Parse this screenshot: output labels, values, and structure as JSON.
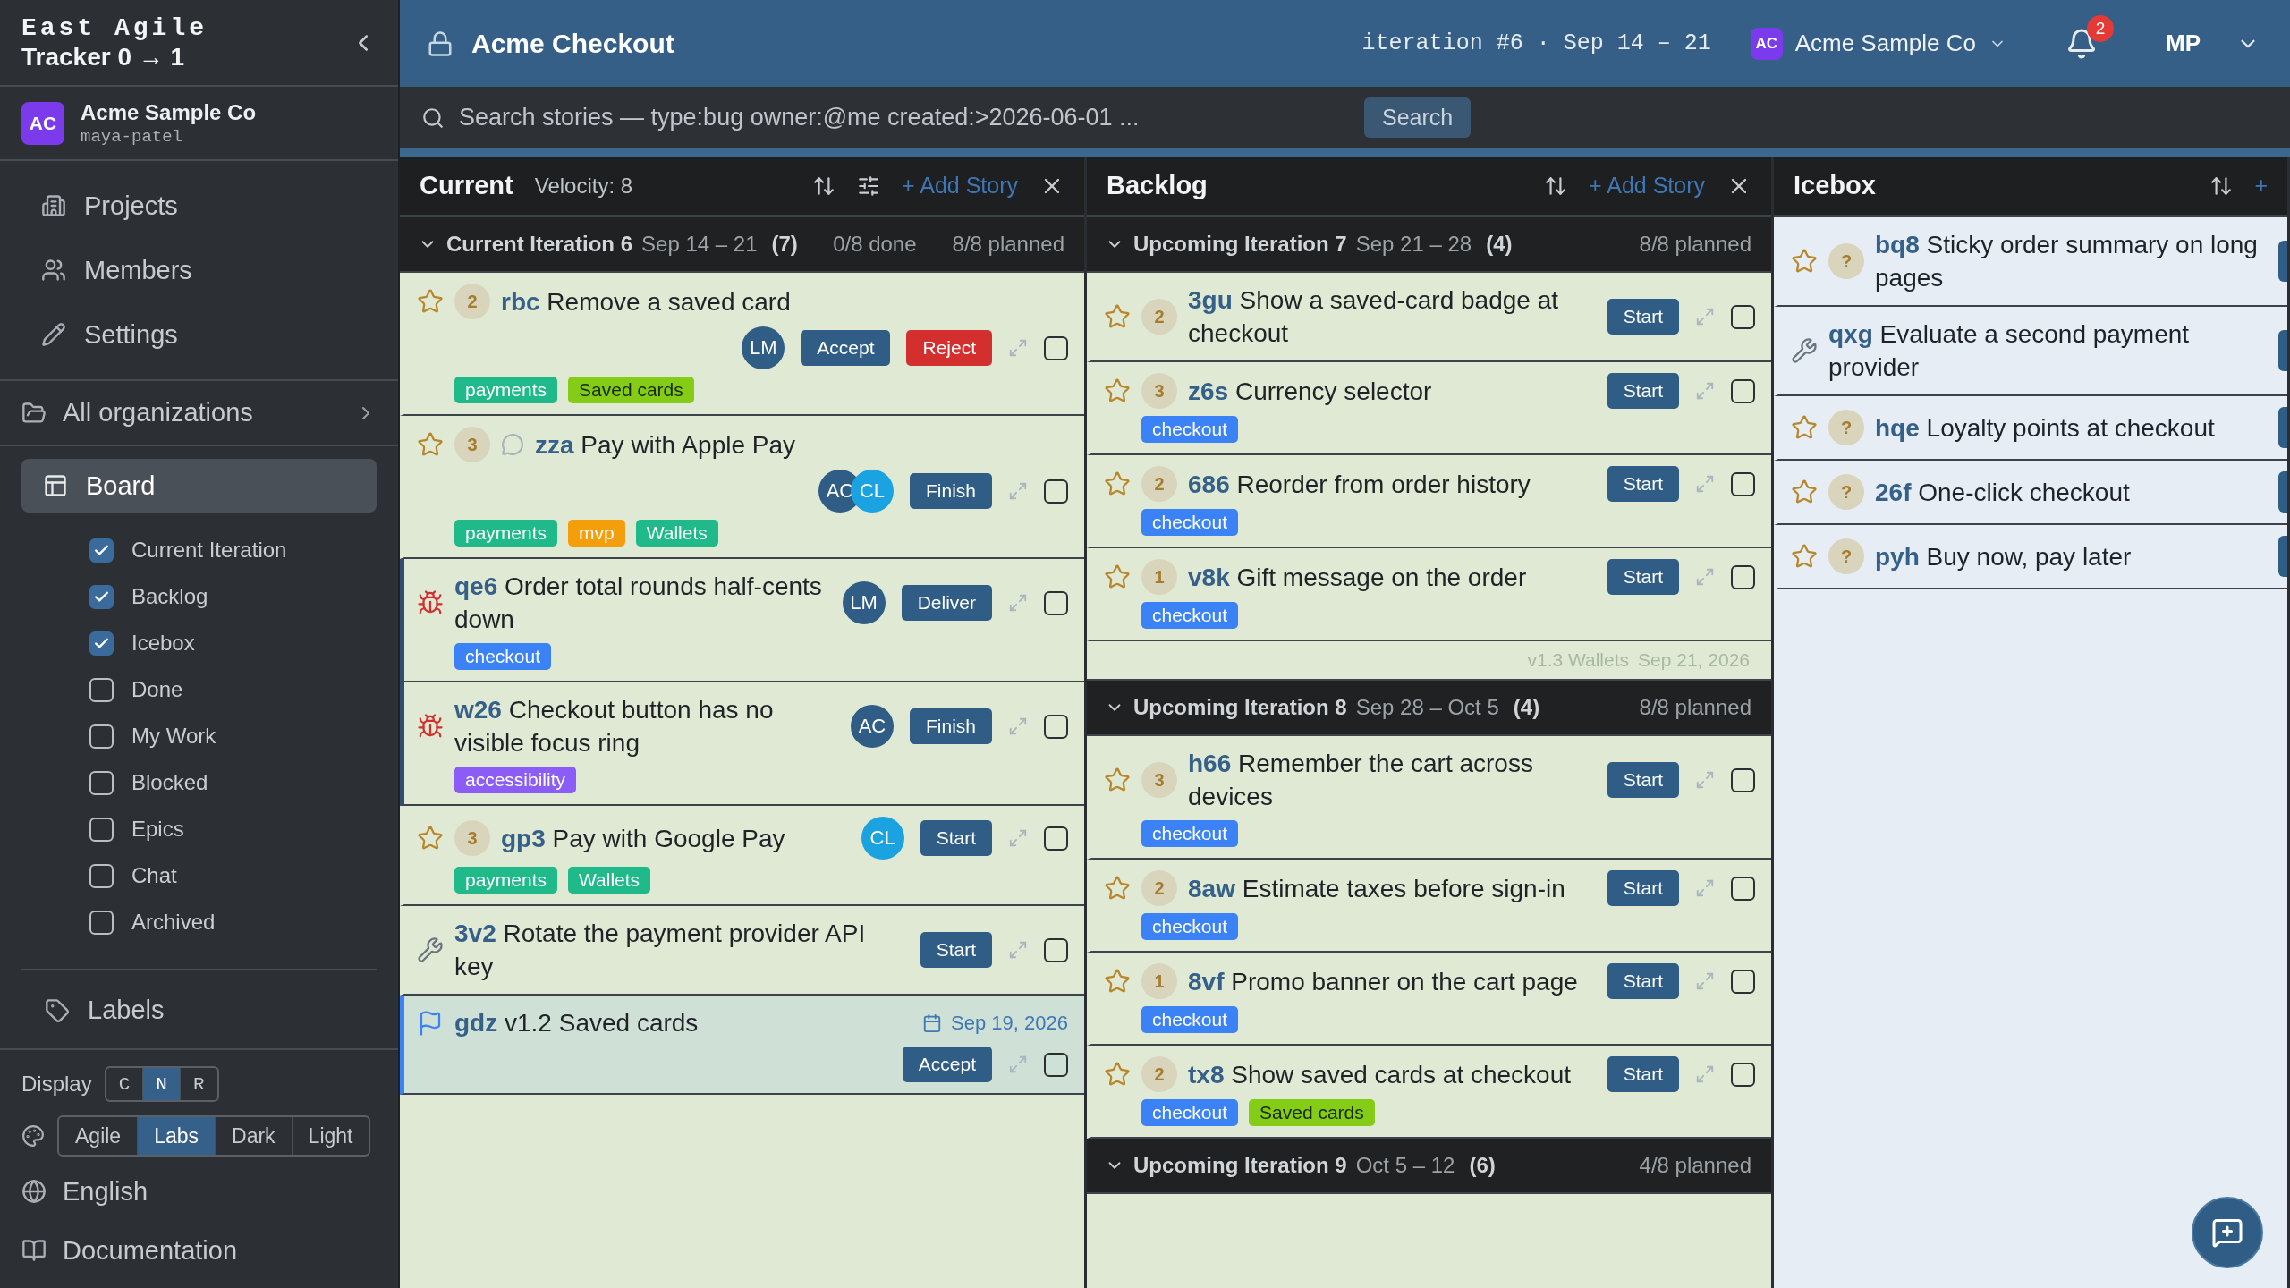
{
  "sidebar": {
    "brand": {
      "line1": "East Agile",
      "line2": "Tracker 0 → 1"
    },
    "org": {
      "avatar": "AC",
      "name": "Acme Sample Co",
      "user": "maya-patel"
    },
    "nav": [
      {
        "kind": "projects",
        "label": "Projects"
      },
      {
        "kind": "members",
        "label": "Members"
      },
      {
        "kind": "settings",
        "label": "Settings"
      }
    ],
    "all_orgs": "All organizations",
    "board": {
      "label": "Board",
      "selected": true
    },
    "panels": [
      {
        "label": "Current Iteration",
        "checked": true
      },
      {
        "label": "Backlog",
        "checked": true
      },
      {
        "label": "Icebox",
        "checked": true
      },
      {
        "label": "Done",
        "checked": false
      },
      {
        "label": "My Work",
        "checked": false
      },
      {
        "label": "Blocked",
        "checked": false
      },
      {
        "label": "Epics",
        "checked": false
      },
      {
        "label": "Chat",
        "checked": false
      },
      {
        "label": "Archived",
        "checked": false
      }
    ],
    "labels": "Labels",
    "display": {
      "label": "Display",
      "options": [
        {
          "label": "C",
          "selected": false
        },
        {
          "label": "N",
          "selected": true
        },
        {
          "label": "R",
          "selected": false
        }
      ]
    },
    "themes": [
      {
        "label": "Agile",
        "selected": false
      },
      {
        "label": "Labs",
        "selected": true
      },
      {
        "label": "Dark",
        "selected": false
      },
      {
        "label": "Light",
        "selected": false
      }
    ],
    "language": "English",
    "docs": "Documentation"
  },
  "header": {
    "project": "Acme Checkout",
    "iteration": "iteration #6 · Sep 14 – 21",
    "org": {
      "avatar": "AC",
      "name": "Acme Sample Co"
    },
    "notifications": "2",
    "user": "MP"
  },
  "search": {
    "placeholder": "Search stories — type:bug owner:@me created:>2026-06-01 ...",
    "button": "Search"
  },
  "columns": [
    {
      "kind": "current",
      "title": "Current",
      "velocity": "Velocity: 8",
      "filter": true,
      "add_story": "+ Add Story",
      "closable": true,
      "cut_off": false,
      "items": [
        {
          "kind": "iteration",
          "title": "Current Iteration 6",
          "dates": "Sep 14 – 21",
          "count": "(7)",
          "done": "0/8 done",
          "planned": "8/8 planned",
          "expanded": true
        },
        {
          "kind": "feature",
          "points": "2",
          "comment": false,
          "id": "rbc",
          "title": "Remove a saved card",
          "owners": [
            {
              "initials": "LM",
              "color": "#2f5d86"
            }
          ],
          "actions": [
            {
              "label": "Accept",
              "kind": "primary"
            },
            {
              "label": "Reject",
              "kind": "danger"
            }
          ],
          "labels": [
            {
              "text": "payments",
              "color": "#1fb98a"
            },
            {
              "text": "Saved cards",
              "color": "#84cc16"
            }
          ],
          "checked": false
        },
        {
          "kind": "feature",
          "points": "3",
          "comment": true,
          "id": "zza",
          "title": "Pay with Apple Pay",
          "owners": [
            {
              "initials": "AC",
              "color": "#2f5d86"
            },
            {
              "initials": "CL",
              "color": "#1aa3e0"
            }
          ],
          "actions": [
            {
              "label": "Finish",
              "kind": "primary"
            }
          ],
          "labels": [
            {
              "text": "payments",
              "color": "#1fb98a"
            },
            {
              "text": "mvp",
              "color": "#f59e0b"
            },
            {
              "text": "Wallets",
              "color": "#1fb98a"
            }
          ],
          "checked": false
        },
        {
          "kind": "bug",
          "comment": false,
          "id": "qe6",
          "title": "Order total rounds half-cents down",
          "owners": [
            {
              "initials": "LM",
              "color": "#2f5d86"
            }
          ],
          "actions": [
            {
              "label": "Deliver",
              "kind": "primary"
            }
          ],
          "labels": [
            {
              "text": "checkout",
              "color": "#3b82f6"
            }
          ],
          "checked": false
        },
        {
          "kind": "bug",
          "comment": false,
          "id": "w26",
          "title": "Checkout button has no visible focus ring",
          "owners": [
            {
              "initials": "AC",
              "color": "#2f5d86"
            }
          ],
          "actions": [
            {
              "label": "Finish",
              "kind": "primary"
            }
          ],
          "labels": [
            {
              "text": "accessibility",
              "color": "#8b5cf6"
            }
          ],
          "checked": false
        },
        {
          "kind": "feature",
          "points": "3",
          "comment": false,
          "id": "gp3",
          "title": "Pay with Google Pay",
          "owners": [
            {
              "initials": "CL",
              "color": "#1aa3e0"
            }
          ],
          "actions": [
            {
              "label": "Start",
              "kind": "primary"
            }
          ],
          "labels": [
            {
              "text": "payments",
              "color": "#1fb98a"
            },
            {
              "text": "Wallets",
              "color": "#1fb98a"
            }
          ],
          "checked": false
        },
        {
          "kind": "chore",
          "comment": false,
          "id": "3v2",
          "title": "Rotate the payment provider API key",
          "actions": [
            {
              "label": "Start",
              "kind": "primary"
            }
          ],
          "checked": false
        },
        {
          "kind": "release",
          "comment": false,
          "id": "gdz",
          "title": "v1.2 Saved cards",
          "date": "Sep 19, 2026",
          "actions": [
            {
              "label": "Accept",
              "kind": "primary"
            }
          ],
          "checked": false
        }
      ]
    },
    {
      "kind": "backlog",
      "title": "Backlog",
      "filter": false,
      "add_story": "+ Add Story",
      "closable": true,
      "cut_off": false,
      "items": [
        {
          "kind": "iteration",
          "title": "Upcoming Iteration 7",
          "dates": "Sep 21 – 28",
          "count": "(4)",
          "planned": "8/8 planned",
          "expanded": true
        },
        {
          "kind": "feature",
          "points": "2",
          "comment": false,
          "id": "3gu",
          "title": "Show a saved-card badge at checkout",
          "actions": [
            {
              "label": "Start",
              "kind": "primary"
            }
          ],
          "checked": false
        },
        {
          "kind": "feature",
          "points": "3",
          "comment": false,
          "id": "z6s",
          "title": "Currency selector",
          "actions": [
            {
              "label": "Start",
              "kind": "primary"
            }
          ],
          "labels": [
            {
              "text": "checkout",
              "color": "#3b82f6"
            }
          ],
          "checked": false
        },
        {
          "kind": "feature",
          "points": "2",
          "comment": false,
          "id": "686",
          "title": "Reorder from order history",
          "actions": [
            {
              "label": "Start",
              "kind": "primary"
            }
          ],
          "labels": [
            {
              "text": "checkout",
              "color": "#3b82f6"
            }
          ],
          "checked": false
        },
        {
          "kind": "feature",
          "points": "1",
          "comment": false,
          "id": "v8k",
          "title": "Gift message on the order",
          "actions": [
            {
              "label": "Start",
              "kind": "primary"
            }
          ],
          "labels": [
            {
              "text": "checkout",
              "color": "#3b82f6"
            }
          ],
          "checked": false
        },
        {
          "kind": "release_marker",
          "name": "v1.3 Wallets",
          "date": "Sep 21, 2026"
        },
        {
          "kind": "iteration",
          "title": "Upcoming Iteration 8",
          "dates": "Sep 28 – Oct 5",
          "count": "(4)",
          "planned": "8/8 planned",
          "expanded": true
        },
        {
          "kind": "feature",
          "points": "3",
          "comment": false,
          "id": "h66",
          "title": "Remember the cart across devices",
          "actions": [
            {
              "label": "Start",
              "kind": "primary"
            }
          ],
          "labels": [
            {
              "text": "checkout",
              "color": "#3b82f6"
            }
          ],
          "checked": false
        },
        {
          "kind": "feature",
          "points": "2",
          "comment": false,
          "id": "8aw",
          "title": "Estimate taxes before sign-in",
          "actions": [
            {
              "label": "Start",
              "kind": "primary"
            }
          ],
          "labels": [
            {
              "text": "checkout",
              "color": "#3b82f6"
            }
          ],
          "checked": false
        },
        {
          "kind": "feature",
          "points": "1",
          "comment": false,
          "id": "8vf",
          "title": "Promo banner on the cart page",
          "actions": [
            {
              "label": "Start",
              "kind": "primary"
            }
          ],
          "labels": [
            {
              "text": "checkout",
              "color": "#3b82f6"
            }
          ],
          "checked": false
        },
        {
          "kind": "feature",
          "points": "2",
          "comment": false,
          "id": "tx8",
          "title": "Show saved cards at checkout",
          "actions": [
            {
              "label": "Start",
              "kind": "primary"
            }
          ],
          "labels": [
            {
              "text": "checkout",
              "color": "#3b82f6"
            },
            {
              "text": "Saved cards",
              "color": "#84cc16"
            }
          ],
          "checked": false
        },
        {
          "kind": "iteration",
          "title": "Upcoming Iteration 9",
          "dates": "Oct 5 – 12",
          "count": "(6)",
          "planned": "4/8 planned",
          "expanded": true
        }
      ]
    },
    {
      "kind": "icebox",
      "title": "Icebox",
      "filter": false,
      "add_story": "+",
      "closable": false,
      "cut_off": true,
      "items": [
        {
          "kind": "feature",
          "points": "?",
          "comment": false,
          "id": "bq8",
          "title": "Sticky order summary on long pages"
        },
        {
          "kind": "chore",
          "comment": false,
          "id": "qxg",
          "title": "Evaluate a second payment provider"
        },
        {
          "kind": "feature",
          "points": "?",
          "comment": false,
          "id": "hqe",
          "title": "Loyalty points at checkout"
        },
        {
          "kind": "feature",
          "points": "?",
          "comment": false,
          "id": "26f",
          "title": "One-click checkout"
        },
        {
          "kind": "feature",
          "points": "?",
          "comment": false,
          "id": "pyh",
          "title": "Buy now, pay later"
        }
      ]
    }
  ]
}
